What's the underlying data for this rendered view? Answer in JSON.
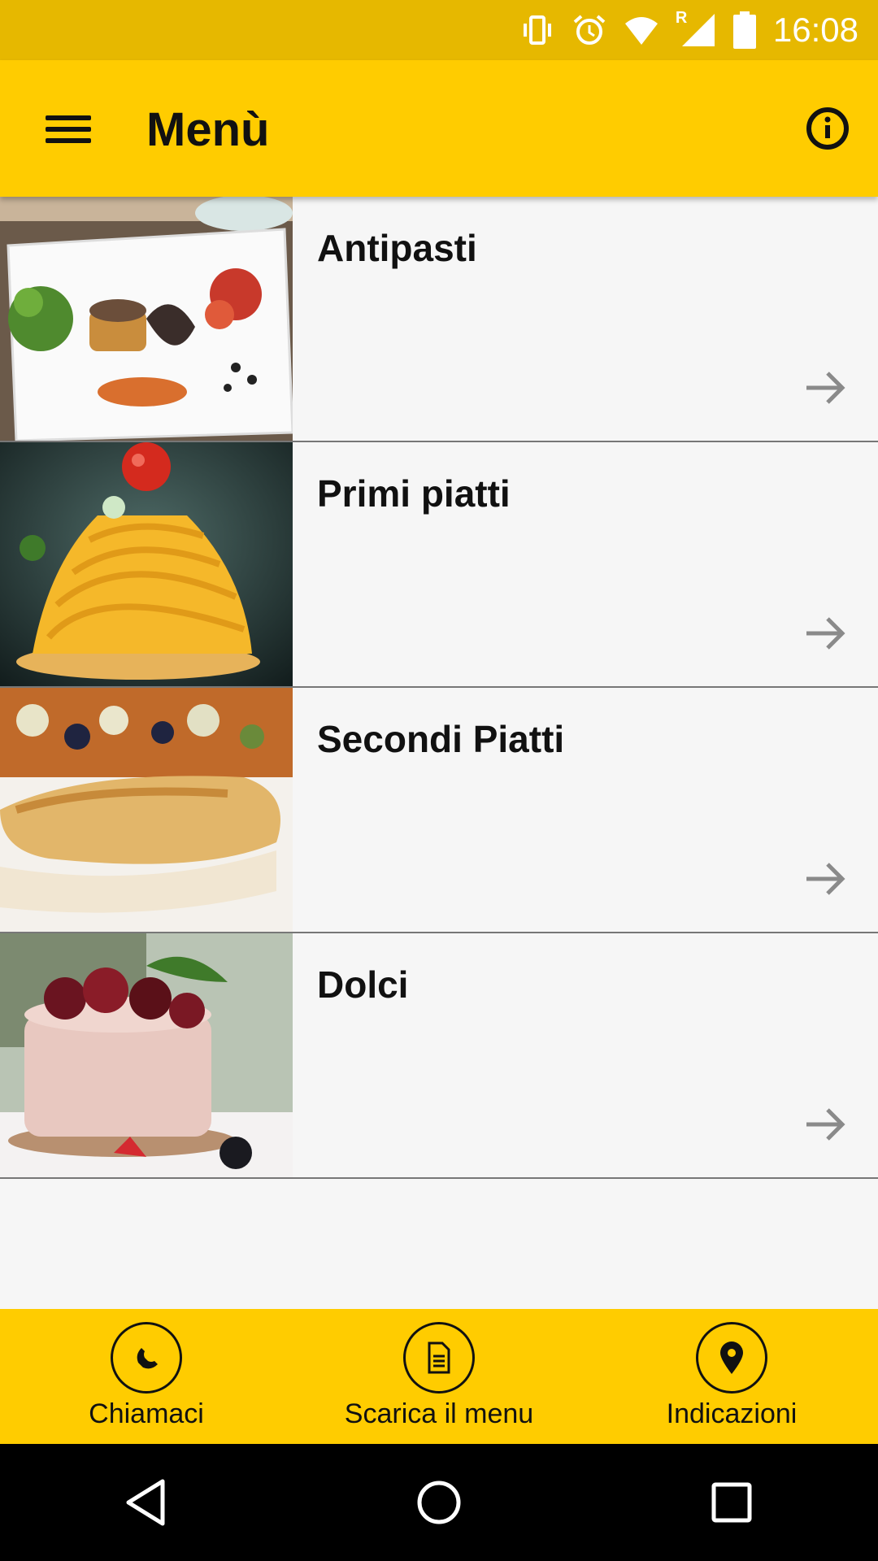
{
  "status_bar": {
    "time": "16:08",
    "icons": [
      "vibrate-icon",
      "alarm-icon",
      "wifi-icon",
      "signal-roaming-icon",
      "battery-icon"
    ],
    "roaming_indicator": "R"
  },
  "app_bar": {
    "title": "Menù",
    "menu_icon": "hamburger-menu-icon",
    "info_icon": "info-icon"
  },
  "categories": [
    {
      "label": "Antipasti",
      "image": "appetizer-plate-photo"
    },
    {
      "label": "Primi piatti",
      "image": "pasta-dish-photo"
    },
    {
      "label": "Secondi Piatti",
      "image": "fish-fillet-photo"
    },
    {
      "label": "Dolci",
      "image": "dessert-photo"
    }
  ],
  "bottom_bar": {
    "call_label": "Chiamaci",
    "download_label": "Scarica il menu",
    "directions_label": "Indicazioni"
  },
  "colors": {
    "status_bar": "#e6b800",
    "accent": "#ffcc00",
    "background": "#f6f6f6",
    "nav_bar": "#000000"
  }
}
